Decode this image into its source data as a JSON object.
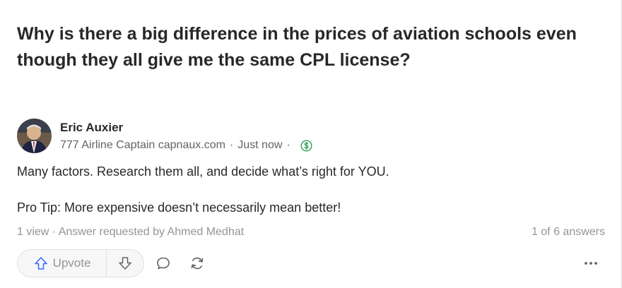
{
  "question": {
    "title": "Why is there a big difference in the prices of aviation schools even though they all give me the same CPL license?"
  },
  "author": {
    "name": "Eric Auxier",
    "credential": "777 Airline Captain capnaux.com",
    "separator": "·",
    "time": "Just now",
    "avatar_icon": "avatar-photo",
    "monetize_icon": "dollar-circle-icon"
  },
  "answer": {
    "paragraph1": "Many factors. Research them all, and decide what’s right for YOU.",
    "paragraph2": "Pro Tip: More expensive doesn’t necessarily mean better!"
  },
  "stats": {
    "text": "1 view · Answer requested by Ahmed Medhat",
    "answers_count": "1 of 6 answers"
  },
  "actions": {
    "upvote_label": "Upvote",
    "upvote_icon": "arrow-up-icon",
    "downvote_icon": "arrow-down-icon",
    "comment_icon": "comment-icon",
    "share_icon": "share-icon",
    "more_icon": "more-dots-icon"
  },
  "colors": {
    "text": "#282829",
    "muted": "#636466",
    "light_muted": "#939598",
    "upvote_blue": "#2e69ff",
    "money_green": "#2e9e4f"
  }
}
